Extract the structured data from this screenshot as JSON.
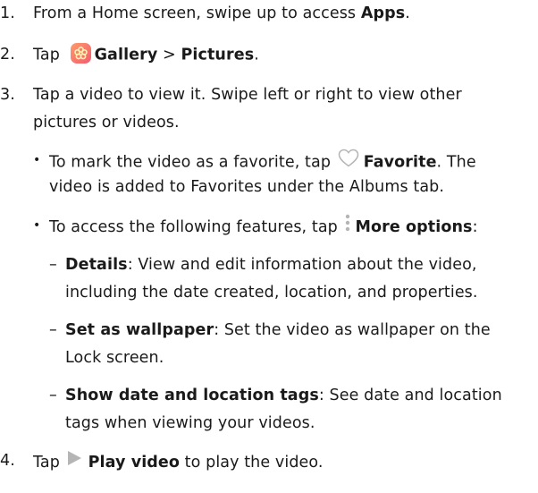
{
  "steps": {
    "s1": {
      "num": "1.",
      "pre": "From a Home screen, swipe up to access ",
      "apps": "Apps",
      "post": "."
    },
    "s2": {
      "num": "2.",
      "pre": "Tap ",
      "gallery": "Gallery",
      "sep": " > ",
      "pictures": "Pictures",
      "post": "."
    },
    "s3": {
      "num": "3.",
      "line1": "Tap a video to view it. Swipe left or right to view other",
      "line2": "pictures or videos."
    },
    "s4": {
      "num": "4.",
      "pre": "Tap ",
      "play": "Play video",
      "post": " to play the video."
    }
  },
  "bullets": {
    "fav": {
      "pre": "To mark the video as a favorite, tap ",
      "label": "Favorite",
      "post": ". The",
      "line2": "video is added to Favorites under the Albums tab."
    },
    "more": {
      "pre": "To access the following features, tap ",
      "label": "More options",
      "post": ":"
    }
  },
  "subitems": {
    "details": {
      "label": "Details",
      "line1": ": View and edit information about the video,",
      "line2": "including the date created, location, and properties."
    },
    "wallpaper": {
      "label": "Set as wallpaper",
      "line1": ": Set the video as wallpaper on the",
      "line2": "Lock screen."
    },
    "tags": {
      "label": "Show date and location tags",
      "line1": ": See date and location",
      "line2": "tags when viewing your videos."
    }
  },
  "icons": {
    "gallery": "gallery-flower-icon",
    "favorite": "heart-outline-icon",
    "more": "vertical-dots-icon",
    "play": "play-triangle-icon"
  },
  "colors": {
    "text": "#1a1a1a",
    "icon_gray": "#b5b5b5",
    "gallery_start": "#ff9a6b",
    "gallery_end": "#f25b6e"
  }
}
